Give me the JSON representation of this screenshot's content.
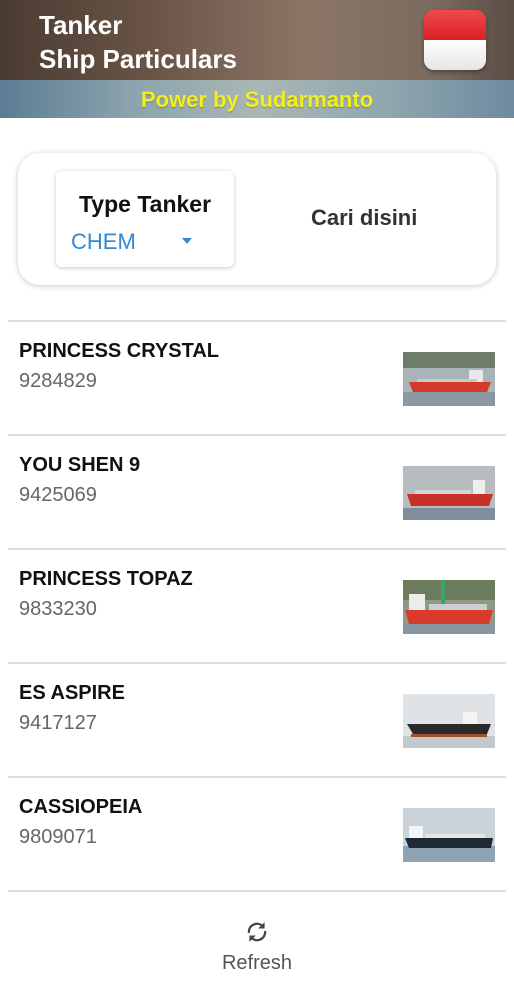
{
  "header": {
    "title_line1": "Tanker",
    "title_line2": "Ship Particulars",
    "flag_icon": "indonesia-flag-icon"
  },
  "banner": {
    "text": "Power by Sudarmanto",
    "text_color": "#f4ef1a"
  },
  "filter": {
    "type_label": "Type Tanker",
    "type_value": "CHEM",
    "dropdown_icon": "arrow-drop-down-icon",
    "search_label": "Cari disini",
    "accent_color": "#2e8ad6"
  },
  "ships": [
    {
      "name": "PRINCESS CRYSTAL",
      "imo": "9284829"
    },
    {
      "name": "YOU SHEN 9",
      "imo": "9425069"
    },
    {
      "name": "PRINCESS TOPAZ",
      "imo": "9833230"
    },
    {
      "name": "ES ASPIRE",
      "imo": "9417127"
    },
    {
      "name": "CASSIOPEIA",
      "imo": "9809071"
    }
  ],
  "bottom": {
    "refresh_icon": "sync-icon",
    "refresh_label": "Refresh"
  }
}
